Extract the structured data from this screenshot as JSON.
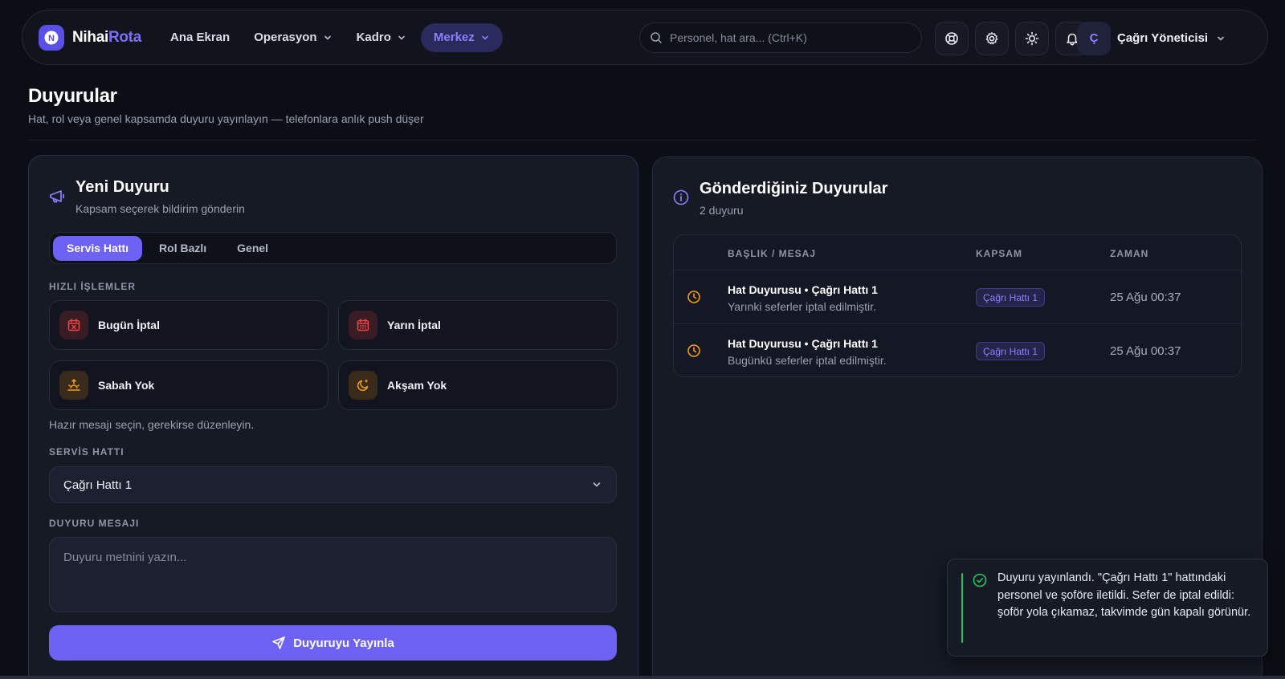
{
  "brand": {
    "name_part1": "Nihai",
    "name_part2": "Rota",
    "logo_letter": "N"
  },
  "nav": {
    "items": [
      {
        "label": "Ana Ekran",
        "has_dropdown": false,
        "active": false
      },
      {
        "label": "Operasyon",
        "has_dropdown": true,
        "active": false
      },
      {
        "label": "Kadro",
        "has_dropdown": true,
        "active": false
      },
      {
        "label": "Merkez",
        "has_dropdown": true,
        "active": true
      }
    ]
  },
  "search": {
    "placeholder": "Personel, hat ara...  (Ctrl+K)"
  },
  "header_icons": [
    "lifebuoy-icon",
    "gear-icon",
    "sun-icon",
    "bell-icon"
  ],
  "user": {
    "initial": "Ç",
    "name": "Çağrı Yöneticisi"
  },
  "page": {
    "title": "Duyurular",
    "subtitle": "Hat, rol veya genel kapsamda duyuru yayınlayın — telefonlara anlık push düşer"
  },
  "compose": {
    "title": "Yeni Duyuru",
    "subtitle": "Kapsam seçerek bildirim gönderin",
    "tabs": [
      {
        "label": "Servis Hattı",
        "active": true
      },
      {
        "label": "Rol Bazlı",
        "active": false
      },
      {
        "label": "Genel",
        "active": false
      }
    ],
    "quick_actions_label": "HIZLI İŞLEMLER",
    "quick_actions": [
      {
        "label": "Bugün İptal",
        "icon": "calendar-x-icon"
      },
      {
        "label": "Yarın İptal",
        "icon": "calendar-icon"
      },
      {
        "label": "Sabah Yok",
        "icon": "sunrise-icon"
      },
      {
        "label": "Akşam Yok",
        "icon": "moon-icon"
      }
    ],
    "hint": "Hazır mesajı seçin, gerekirse düzenleyin.",
    "line_label": "SERVİS HATTI",
    "line_value": "Çağrı Hattı 1",
    "message_label": "DUYURU MESAJI",
    "message_placeholder": "Duyuru metnini yazın...",
    "publish_label": "Duyuruyu Yayınla"
  },
  "sent": {
    "title": "Gönderdiğiniz Duyurular",
    "count_label": "2 duyuru",
    "columns": [
      "BAŞLIK / MESAJ",
      "KAPSAM",
      "ZAMAN"
    ],
    "rows": [
      {
        "title": "Hat Duyurusu • Çağrı Hattı 1",
        "message": "Yarınki seferler iptal edilmiştir.",
        "scope": "Çağrı Hattı 1",
        "time": "25 Ağu 00:37"
      },
      {
        "title": "Hat Duyurusu • Çağrı Hattı 1",
        "message": "Bugünkü seferler iptal edilmiştir.",
        "scope": "Çağrı Hattı 1",
        "time": "25 Ağu 00:37"
      }
    ]
  },
  "toast": {
    "message": "Duyuru yayınlandı. \"Çağrı Hattı 1\" hattındaki personel ve şoföre iletildi. Sefer de iptal edildi: şoför yola çıkamaz, takvimde gün kapalı görünür."
  },
  "colors": {
    "accent": "#6e62f5",
    "accent_text": "#8c80ff",
    "danger": "#ef4444",
    "warning": "#f59e0b",
    "success": "#22c55e",
    "background": "#0c0e15",
    "card": "#161a25"
  }
}
